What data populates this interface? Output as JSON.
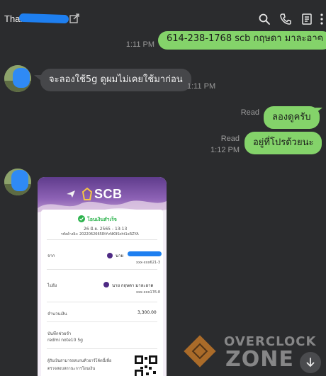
{
  "header": {
    "chat_name": "Thano"
  },
  "messages": [
    {
      "dir": "out",
      "text": "614-238-1768 scb กฤษดา มาละอาด",
      "time": "1:11 PM",
      "read": ""
    },
    {
      "dir": "in",
      "text": "จะลองใช้5g ดูผมไม่เคยใช้มาก่อน",
      "time": "1:11 PM"
    },
    {
      "dir": "out",
      "text": "ลองดูครับ",
      "read": "Read",
      "time": ""
    },
    {
      "dir": "out",
      "text": "อยู่ที่โปรด้วยนะ",
      "read": "Read",
      "time": "1:12 PM"
    }
  ],
  "slip": {
    "bank_logo": "SCB",
    "status": "โอนเงินสำเร็จ",
    "datetime": "26 มิ.ย. 2565 - 13:13",
    "ref": "รหัสอ้างอิง: 2022062665RtYvNK9Scht1xRZYA",
    "from_label": "จาก",
    "from_name": "นาย",
    "from_account": "xxx-xxx621-3",
    "to_label": "ไปยัง",
    "to_name": "นาย กฤษดา มาละอาด",
    "to_account": "xxx-xxx176-8",
    "amount_label": "จำนวนเงิน",
    "amount": "3,300.00",
    "note_label": "บันทึกช่วยจำ",
    "note": "redmi note10 5g",
    "footer": "ผู้รับเงินสามารถสแกนคิวอาร์โค้ดนี้เพื่อ",
    "footer2": "ตรวจสอบสถานะการโอนเงิน"
  },
  "watermark": {
    "line1": "OVERCLOCK",
    "line2": "ZONE"
  },
  "colors": {
    "background": "#2b2c2e",
    "outgoing_bubble": "#84d36a",
    "incoming_bubble": "#46474a"
  }
}
